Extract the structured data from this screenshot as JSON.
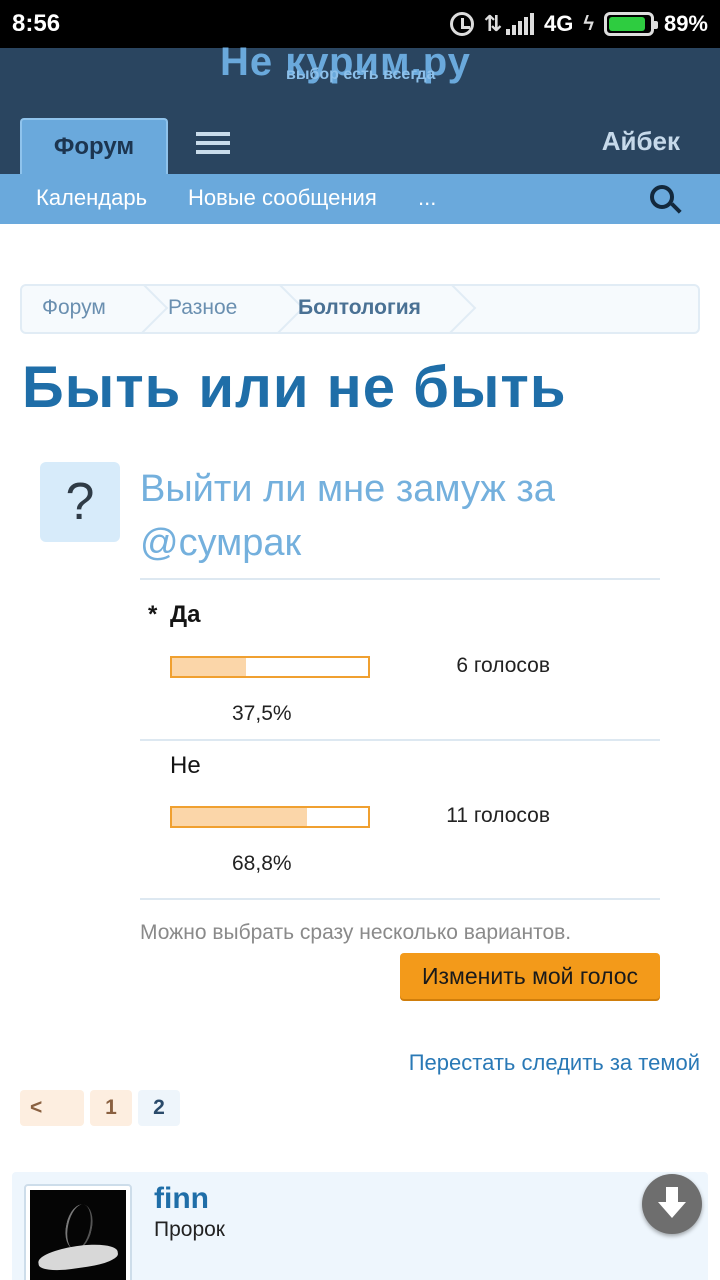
{
  "status_bar": {
    "time": "8:56",
    "network": "4G",
    "battery": "89%",
    "battery_level": 0.89,
    "icons": [
      "alarm-icon",
      "data-transfer-icon",
      "signal-icon",
      "charging-icon",
      "battery-icon"
    ]
  },
  "header": {
    "logo_text": "Не  курим.ру",
    "logo_tagline": "выбор есть всегда",
    "tab_label": "Форум",
    "username": "Айбек"
  },
  "subnav": {
    "items": [
      "Календарь",
      "Новые сообщения",
      "..."
    ]
  },
  "breadcrumb": [
    "Форум",
    "Разное",
    "Болтология"
  ],
  "page_title": "Быть или не быть",
  "poll": {
    "question": "Выйти ли мне замуж за @сумрак",
    "options": [
      {
        "marker": "*",
        "label": "Да",
        "votes_text": "6 голосов",
        "percent_text": "37,5%",
        "percent": 37.5
      },
      {
        "marker": "",
        "label": "Не",
        "votes_text": "11 голосов",
        "percent_text": "68,8%",
        "percent": 68.8
      }
    ],
    "multi_note": "Можно выбрать сразу несколько вариантов.",
    "vote_button": "Изменить мой голос"
  },
  "unfollow_link": "Перестать следить за темой",
  "pagination": {
    "prev_label": "<",
    "pages": [
      "1",
      "2"
    ],
    "current_page": "2"
  },
  "post": {
    "username": "finn",
    "user_title": "Пророк"
  },
  "colors": {
    "header_bg": "#2a4560",
    "nav_bg": "#6aa9dc",
    "title": "#1f6ea8",
    "accent_button": "#f39a1a",
    "poll_bar_fill": "#fbd6a9",
    "poll_bar_border": "#f0a030"
  }
}
